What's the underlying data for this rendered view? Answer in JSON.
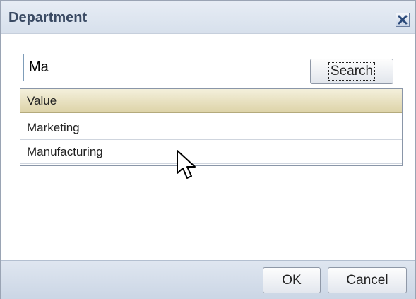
{
  "dialog": {
    "title": "Department",
    "close_icon": "close-icon"
  },
  "search": {
    "value": "Ma",
    "button_label": "Search"
  },
  "results": {
    "column_header": "Value",
    "rows": [
      "Marketing",
      "Manufacturing"
    ]
  },
  "footer": {
    "ok_label": "OK",
    "cancel_label": "Cancel"
  },
  "colors": {
    "title_text": "#3a4a63",
    "header_band": "#e7edf5",
    "table_header": "#ddd3a8"
  }
}
